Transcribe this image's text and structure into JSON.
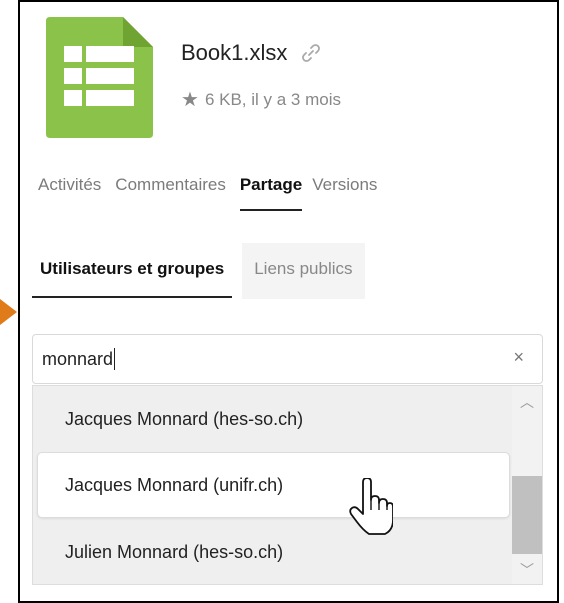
{
  "file": {
    "name": "Book1.xlsx",
    "meta": "6 KB, il y a 3 mois",
    "icon": "spreadsheet-icon",
    "icon_color": "#8bc34a"
  },
  "tabs": [
    {
      "label": "Activités",
      "active": false
    },
    {
      "label": "Commentaires",
      "active": false
    },
    {
      "label": "Partage",
      "active": true
    },
    {
      "label": "Versions",
      "active": false
    }
  ],
  "subtabs": [
    {
      "label": "Utilisateurs et groupes",
      "active": true
    },
    {
      "label": "Liens publics",
      "active": false
    }
  ],
  "search": {
    "value": "monnard",
    "clear_label": "×"
  },
  "results": [
    {
      "label": "Jacques Monnard (hes-so.ch)"
    },
    {
      "label": "Jacques Monnard (unifr.ch)",
      "hover": true
    },
    {
      "label": "Julien Monnard (hes-so.ch)"
    }
  ],
  "colors": {
    "accent_arrow": "#e07b1a",
    "border": "#000000"
  }
}
